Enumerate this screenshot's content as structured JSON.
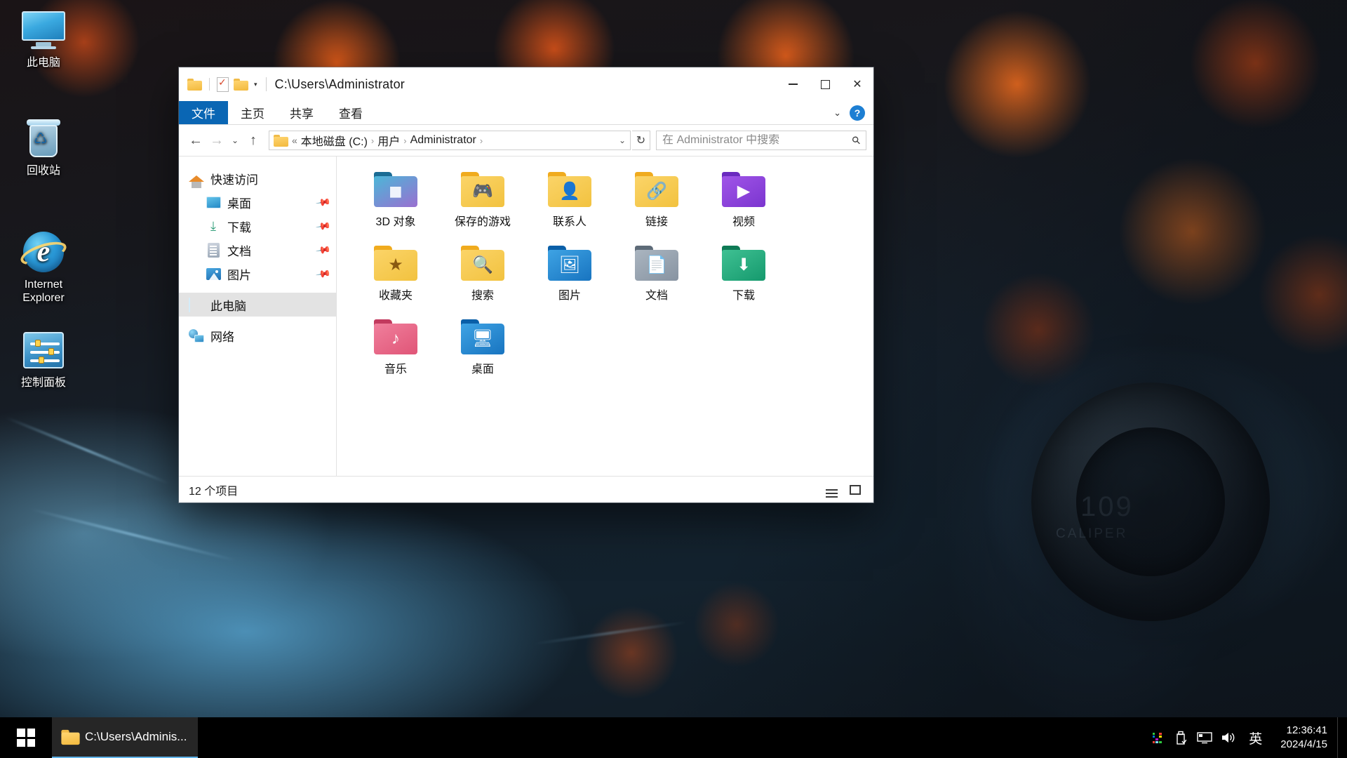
{
  "desktop": {
    "icons": [
      {
        "name": "this-pc",
        "label": "此电脑",
        "icon": "monitor-icon"
      },
      {
        "name": "recycle-bin",
        "label": "回收站",
        "icon": "recycle-bin-icon"
      },
      {
        "name": "internet-explorer",
        "label": "Internet Explorer",
        "icon": "internet-explorer-icon"
      },
      {
        "name": "control-panel",
        "label": "控制面板",
        "icon": "control-panel-icon"
      }
    ]
  },
  "window": {
    "title": "C:\\Users\\Administrator",
    "quick_access": {
      "folder_icon": "folder-icon",
      "properties_icon": "properties-icon",
      "new_folder_icon": "new-folder-icon",
      "customize_caret": "▾"
    },
    "controls": {
      "minimize": "minimize-button",
      "maximize": "maximize-button",
      "close": "✕"
    },
    "ribbon": {
      "tabs": [
        {
          "label": "文件",
          "active": true
        },
        {
          "label": "主页",
          "active": false
        },
        {
          "label": "共享",
          "active": false
        },
        {
          "label": "查看",
          "active": false
        }
      ],
      "collapse_caret": "⌄",
      "help_label": "?"
    },
    "address": {
      "back": "←",
      "forward": "→",
      "recent_caret": "⌄",
      "up": "↑",
      "folder_icon": "folder-icon",
      "overflow": "«",
      "crumbs": [
        "本地磁盘 (C:)",
        "用户",
        "Administrator"
      ],
      "crumb_separator": "›",
      "trailing_separator": "›",
      "dropdown_caret": "⌄",
      "refresh": "↻"
    },
    "search": {
      "placeholder": "在 Administrator 中搜索",
      "value": "",
      "icon": "search-icon"
    },
    "nav_pane": {
      "items": [
        {
          "label": "快速访问",
          "icon": "quick-access-home-icon",
          "indent": false,
          "pinned": false,
          "selected": false
        },
        {
          "label": "桌面",
          "icon": "desktop-icon",
          "indent": true,
          "pinned": true,
          "selected": false
        },
        {
          "label": "下载",
          "icon": "downloads-icon",
          "indent": true,
          "pinned": true,
          "selected": false
        },
        {
          "label": "文档",
          "icon": "documents-icon",
          "indent": true,
          "pinned": true,
          "selected": false
        },
        {
          "label": "图片",
          "icon": "pictures-icon",
          "indent": true,
          "pinned": true,
          "selected": false
        },
        {
          "label": "此电脑",
          "icon": "this-pc-icon",
          "indent": false,
          "pinned": false,
          "selected": true
        },
        {
          "label": "网络",
          "icon": "network-icon",
          "indent": false,
          "pinned": false,
          "selected": false
        }
      ],
      "pin_glyph": "📌"
    },
    "files": [
      {
        "label": "3D 对象",
        "icon": "folder-3d-objects-icon",
        "tab_color": "#1b6c94",
        "body_color_a": "#4bb7d8",
        "body_color_b": "#9a6fd0",
        "glyph": "◼",
        "glyph_color": "#eef3fb"
      },
      {
        "label": "保存的游戏",
        "icon": "folder-saved-games-icon",
        "tab_color": "#f0ab1e",
        "body_color_a": "#fbd468",
        "body_color_b": "#f2c23f",
        "glyph": "🎮",
        "glyph_color": "#a8711a"
      },
      {
        "label": "联系人",
        "icon": "folder-contacts-icon",
        "tab_color": "#f0ab1e",
        "body_color_a": "#fbd468",
        "body_color_b": "#f2c23f",
        "glyph": "👤",
        "glyph_color": "#a8711a"
      },
      {
        "label": "链接",
        "icon": "folder-links-icon",
        "tab_color": "#f0ab1e",
        "body_color_a": "#fbd468",
        "body_color_b": "#f2c23f",
        "glyph": "🔗",
        "glyph_color": "#a8711a"
      },
      {
        "label": "视频",
        "icon": "folder-videos-icon",
        "tab_color": "#6a2bbf",
        "body_color_a": "#a055e8",
        "body_color_b": "#7b35cf",
        "glyph": "▶",
        "glyph_color": "#ffffff"
      },
      {
        "label": "收藏夹",
        "icon": "folder-favorites-icon",
        "tab_color": "#f0ab1e",
        "body_color_a": "#fbd468",
        "body_color_b": "#f2c23f",
        "glyph": "★",
        "glyph_color": "#8a5a12"
      },
      {
        "label": "搜索",
        "icon": "folder-searches-icon",
        "tab_color": "#f0ab1e",
        "body_color_a": "#fbd468",
        "body_color_b": "#f2c23f",
        "glyph": "🔍",
        "glyph_color": "#8a5a12"
      },
      {
        "label": "图片",
        "icon": "folder-pictures-icon",
        "tab_color": "#0a5fa8",
        "body_color_a": "#3ea3e4",
        "body_color_b": "#1874c0",
        "glyph": "🖼",
        "glyph_color": "#ffffff"
      },
      {
        "label": "文档",
        "icon": "folder-documents-icon",
        "tab_color": "#5e6b78",
        "body_color_a": "#aab5c0",
        "body_color_b": "#8793a1",
        "glyph": "📄",
        "glyph_color": "#ffffff"
      },
      {
        "label": "下载",
        "icon": "folder-downloads-icon",
        "tab_color": "#0e7a55",
        "body_color_a": "#3fc193",
        "body_color_b": "#15996d",
        "glyph": "⬇",
        "glyph_color": "#ffffff"
      },
      {
        "label": "音乐",
        "icon": "folder-music-icon",
        "tab_color": "#c23a5e",
        "body_color_a": "#f07f9c",
        "body_color_b": "#e05577",
        "glyph": "♪",
        "glyph_color": "#ffffff"
      },
      {
        "label": "桌面",
        "icon": "folder-desktop-icon",
        "tab_color": "#0a5fa8",
        "body_color_a": "#3ea3e4",
        "body_color_b": "#1874c0",
        "glyph": "🖥",
        "glyph_color": "#ffffff"
      }
    ],
    "status": {
      "count_text": "12 个项目",
      "view_details_icon": "details-view-icon",
      "view_large_icons_icon": "large-icons-view-icon"
    }
  },
  "taskbar": {
    "start_icon": "windows-start-icon",
    "tasks": [
      {
        "label": "C:\\Users\\Adminis...",
        "icon": "folder-icon",
        "active": true
      }
    ],
    "tray": [
      {
        "name": "color-grid-icon",
        "glyph": ""
      },
      {
        "name": "usb-eject-icon",
        "glyph": ""
      },
      {
        "name": "display-icon",
        "glyph": ""
      },
      {
        "name": "volume-icon",
        "glyph": "🔊"
      }
    ],
    "language": "英",
    "clock": {
      "time": "12:36:41",
      "date": "2024/4/15"
    },
    "show_desktop": "show-desktop-button"
  }
}
